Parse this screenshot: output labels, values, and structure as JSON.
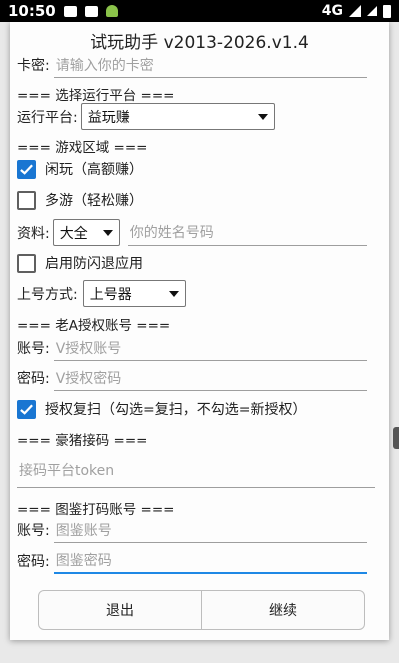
{
  "status_bar": {
    "time": "10:50",
    "network": "4G",
    "icons": [
      "notification-icon",
      "photo-icon",
      "android-icon",
      "signal-icon",
      "wifi-icon",
      "battery-icon"
    ]
  },
  "dialog": {
    "title": "试玩助手 v2013-2026.v1.4",
    "card_key": {
      "label": "卡密:",
      "placeholder": "请输入你的卡密"
    },
    "platform_section": "=== 选择运行平台 ===",
    "platform": {
      "label": "运行平台:",
      "value": "益玩赚"
    },
    "game_section": "=== 游戏区域 ===",
    "game_option_1": {
      "label": "闲玩（高额赚）",
      "checked": true
    },
    "game_option_2": {
      "label": "多游（轻松赚）",
      "checked": false
    },
    "info": {
      "label": "资料:",
      "select_value": "大全",
      "placeholder": "你的姓名号码"
    },
    "anti_crash": {
      "label": "启用防闪退应用",
      "checked": false
    },
    "login_method": {
      "label": "上号方式:",
      "value": "上号器"
    },
    "laoa_section": "=== 老A授权账号 ===",
    "laoa_account": {
      "label": "账号:",
      "placeholder": "V授权账号"
    },
    "laoa_password": {
      "label": "密码:",
      "placeholder": "V授权密码"
    },
    "rescan": {
      "label": "授权复扫（勾选=复扫，不勾选=新授权）",
      "checked": true
    },
    "haozhu_section": "=== 豪猪接码 ===",
    "token": {
      "placeholder": "接码平台token"
    },
    "tujian_section": "=== 图鉴打码账号 ===",
    "tujian_account": {
      "label": "账号:",
      "placeholder": "图鉴账号"
    },
    "tujian_password": {
      "label": "密码:",
      "placeholder": "图鉴密码"
    },
    "exit_label": "退出",
    "continue_label": "继续"
  },
  "colors": {
    "accent": "#1976d2",
    "focus_underline": "#1e88e5"
  }
}
